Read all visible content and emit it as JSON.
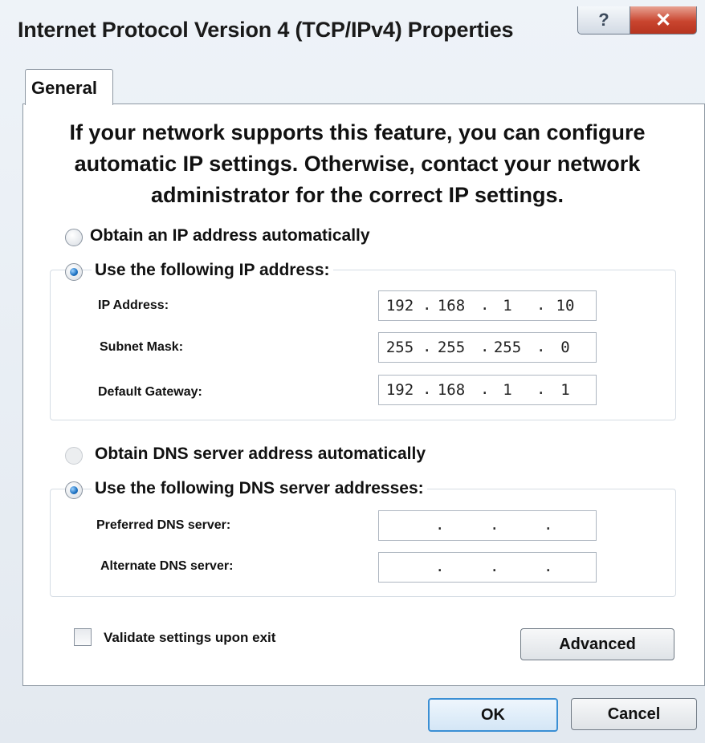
{
  "window": {
    "title": "Internet Protocol Version 4 (TCP/IPv4) Properties",
    "help_glyph": "?",
    "close_glyph": "✕"
  },
  "tabs": [
    "General"
  ],
  "intro_text": "If your network supports this feature, you can configure automatic IP settings. Otherwise, contact your network administrator for the correct IP settings.",
  "ip": {
    "auto_label": "Obtain an IP address automatically",
    "manual_label": "Use the following IP address:",
    "selected": "manual",
    "fields": [
      {
        "label": "IP Address:",
        "octets": [
          "192",
          "168",
          "1",
          "10"
        ]
      },
      {
        "label": "Subnet Mask:",
        "octets": [
          "255",
          "255",
          "255",
          "0"
        ]
      },
      {
        "label": "Default Gateway:",
        "octets": [
          "192",
          "168",
          "1",
          "1"
        ]
      }
    ]
  },
  "dns": {
    "auto_label": "Obtain DNS server address automatically",
    "manual_label": "Use the following DNS server addresses:",
    "selected": "manual",
    "fields": [
      {
        "label": "Preferred DNS server:",
        "octets": [
          "",
          "",
          "",
          ""
        ]
      },
      {
        "label": "Alternate DNS server:",
        "octets": [
          "",
          "",
          "",
          ""
        ]
      }
    ]
  },
  "validate_label": "Validate settings upon exit",
  "validate_checked": false,
  "buttons": {
    "advanced": "Advanced",
    "ok": "OK",
    "cancel": "Cancel"
  }
}
